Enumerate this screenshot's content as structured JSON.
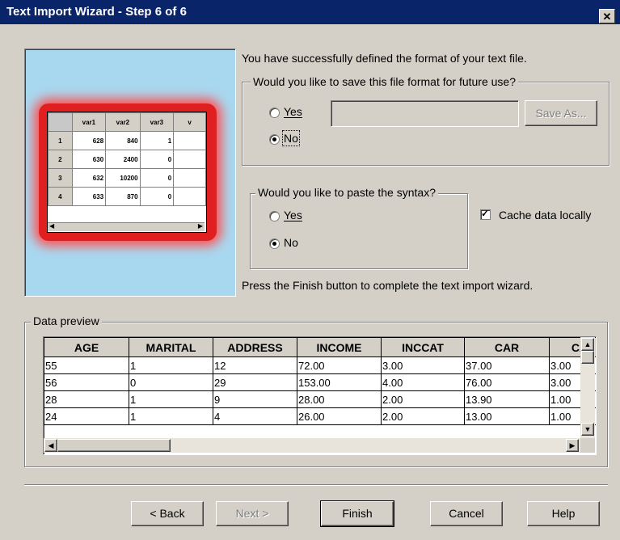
{
  "window": {
    "title": "Text Import Wizard - Step 6 of 6",
    "close_glyph": "✕"
  },
  "intro_text": "You have successfully defined the format of your text file.",
  "save_format": {
    "legend": "Would you like to save this file format for future use?",
    "yes_label": "Yes",
    "no_label": "No",
    "selected": "No",
    "filename_value": "",
    "save_as_label": "Save As..."
  },
  "paste_syntax": {
    "legend": "Would you like to paste the syntax?",
    "yes_label": "Yes",
    "no_label": "No",
    "selected": "No"
  },
  "cache": {
    "label": "Cache data locally",
    "checked": true
  },
  "finish_text": "Press the Finish button to complete the text import wizard.",
  "illustration": {
    "columns": [
      "var1",
      "var2",
      "var3",
      "v"
    ],
    "rows": [
      [
        "1",
        "628",
        "840",
        "1",
        ""
      ],
      [
        "2",
        "630",
        "2400",
        "0",
        ""
      ],
      [
        "3",
        "632",
        "10200",
        "0",
        ""
      ],
      [
        "4",
        "633",
        "870",
        "0",
        ""
      ]
    ]
  },
  "data_preview": {
    "legend": "Data preview",
    "columns": [
      "AGE",
      "MARITAL",
      "ADDRESS",
      "INCOME",
      "INCCAT",
      "CAR",
      "CA"
    ],
    "rows": [
      [
        "55",
        "1",
        "12",
        "72.00",
        "3.00",
        "37.00",
        "3.00"
      ],
      [
        "56",
        "0",
        "29",
        "153.00",
        "4.00",
        "76.00",
        "3.00"
      ],
      [
        "28",
        "1",
        "9",
        "28.00",
        "2.00",
        "13.90",
        "1.00"
      ],
      [
        "24",
        "1",
        "4",
        "26.00",
        "2.00",
        "13.00",
        "1.00"
      ]
    ]
  },
  "buttons": {
    "back": "< Back",
    "next": "Next >",
    "finish": "Finish",
    "cancel": "Cancel",
    "help": "Help"
  }
}
